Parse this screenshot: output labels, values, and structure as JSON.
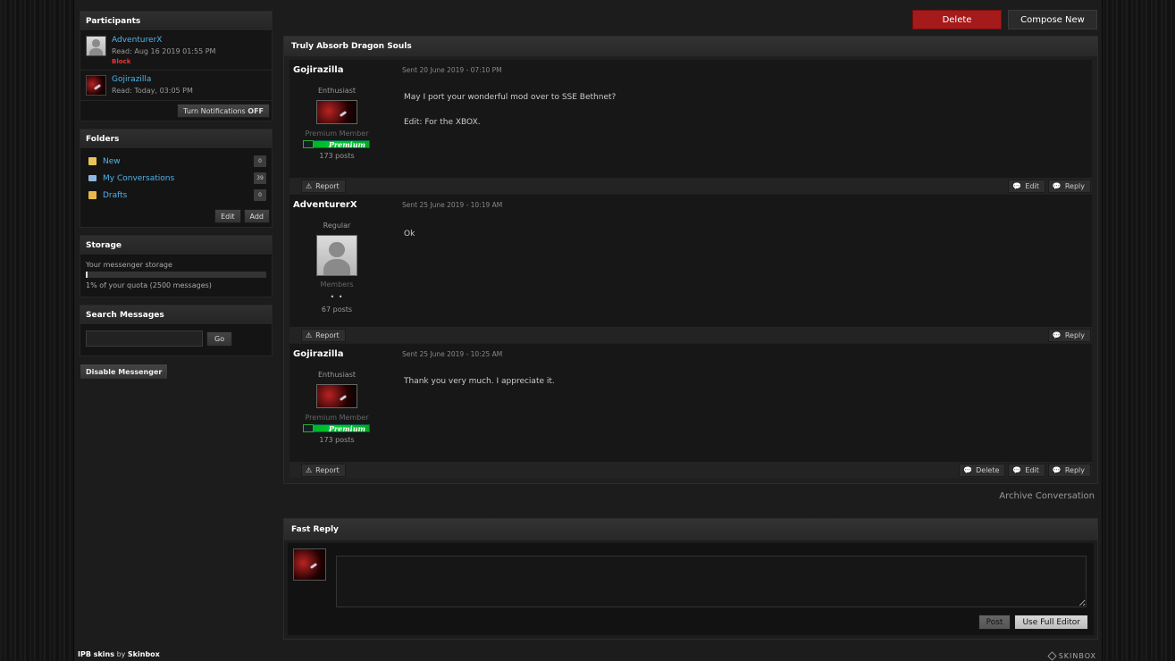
{
  "header": {
    "delete_label": "Delete",
    "compose_label": "Compose New"
  },
  "sidebar": {
    "participants": {
      "title": "Participants",
      "items": [
        {
          "name": "AdventurerX",
          "read": "Read: Aug 16 2019 01:55 PM",
          "block": "Block",
          "avatar": "default-avatar"
        },
        {
          "name": "Gojirazilla",
          "read": "Read: Today, 03:05 PM",
          "avatar": "starship-avatar"
        }
      ],
      "notifications_label": "Turn Notifications",
      "notifications_state": "OFF"
    },
    "folders": {
      "title": "Folders",
      "items": [
        {
          "name": "New",
          "count": "0",
          "icon": "folder-new-icon",
          "color": "#e8c35a"
        },
        {
          "name": "My Conversations",
          "count": "39",
          "icon": "envelope-icon",
          "color": "#8fb8e0"
        },
        {
          "name": "Drafts",
          "count": "0",
          "icon": "drafts-folder-icon",
          "color": "#e6b84d"
        }
      ],
      "edit_label": "Edit",
      "add_label": "Add"
    },
    "storage": {
      "title": "Storage",
      "label": "Your messenger storage",
      "quota_text": "1% of your quota (2500 messages)",
      "percent": 1
    },
    "search": {
      "title": "Search Messages",
      "placeholder": "",
      "go_label": "Go"
    },
    "disable_label": "Disable Messenger"
  },
  "conversation": {
    "title": "Truly Absorb Dragon Souls",
    "posts": [
      {
        "author": "Gojirazilla",
        "date": "Sent 20 June 2019 - 07:10 PM",
        "rank": "Enthusiast",
        "group": "Premium Member",
        "badge": "Premium",
        "posts": "173 posts",
        "body": [
          "May I port your wonderful mod over to SSE Bethnet?",
          "Edit: For the XBOX."
        ],
        "report": "Report",
        "edit": "Edit",
        "reply": "Reply"
      },
      {
        "author": "AdventurerX",
        "date": "Sent 25 June 2019 - 10:19 AM",
        "rank": "Regular",
        "group": "Members",
        "pips": "• •",
        "posts": "67 posts",
        "body": [
          "Ok"
        ],
        "report": "Report",
        "reply": "Reply"
      },
      {
        "author": "Gojirazilla",
        "date": "Sent 25 June 2019 - 10:25 AM",
        "rank": "Enthusiast",
        "group": "Premium Member",
        "badge": "Premium",
        "posts": "173 posts",
        "body": [
          "Thank you very much. I appreciate it."
        ],
        "report": "Report",
        "delete": "Delete",
        "edit": "Edit",
        "reply": "Reply"
      }
    ],
    "archive_label": "Archive Conversation"
  },
  "fast_reply": {
    "title": "Fast Reply",
    "post_label": "Post",
    "full_editor_label": "Use Full Editor"
  },
  "footer": {
    "skins_prefix": "IPB skins",
    "by": "by",
    "brand": "Skinbox",
    "logo_text": "SKINBOX"
  }
}
